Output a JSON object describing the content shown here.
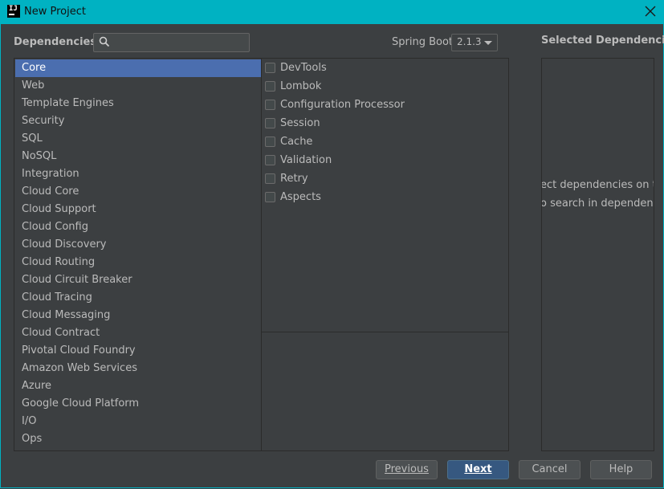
{
  "window": {
    "title": "New Project",
    "icon": "intellij-idea-icon",
    "title_bar_color": "#00b2c2"
  },
  "header": {
    "dependencies_label": "Dependencies",
    "search": {
      "value": "",
      "placeholder": ""
    },
    "spring_boot_label": "Spring Boot",
    "spring_boot_version": "2.1.3"
  },
  "categories": [
    "Core",
    "Web",
    "Template Engines",
    "Security",
    "SQL",
    "NoSQL",
    "Integration",
    "Cloud Core",
    "Cloud Support",
    "Cloud Config",
    "Cloud Discovery",
    "Cloud Routing",
    "Cloud Circuit Breaker",
    "Cloud Tracing",
    "Cloud Messaging",
    "Cloud Contract",
    "Pivotal Cloud Foundry",
    "Amazon Web Services",
    "Azure",
    "Google Cloud Platform",
    "I/O",
    "Ops"
  ],
  "selected_category": "Core",
  "dependencies": [
    {
      "label": "DevTools",
      "checked": false
    },
    {
      "label": "Lombok",
      "checked": false
    },
    {
      "label": "Configuration Processor",
      "checked": false
    },
    {
      "label": "Session",
      "checked": false
    },
    {
      "label": "Cache",
      "checked": false
    },
    {
      "label": "Validation",
      "checked": false
    },
    {
      "label": "Retry",
      "checked": false
    },
    {
      "label": "Aspects",
      "checked": false
    }
  ],
  "selected_panel": {
    "title": "Selected Dependencies",
    "hint_line1": "ect dependencies on the",
    "hint_line2": "o search in dependencie"
  },
  "buttons": {
    "previous": "Previous",
    "next": "Next",
    "cancel": "Cancel",
    "help": "Help"
  },
  "colors": {
    "selection": "#4b6eaf",
    "primary_button": "#365880",
    "background": "#3c3f41"
  }
}
